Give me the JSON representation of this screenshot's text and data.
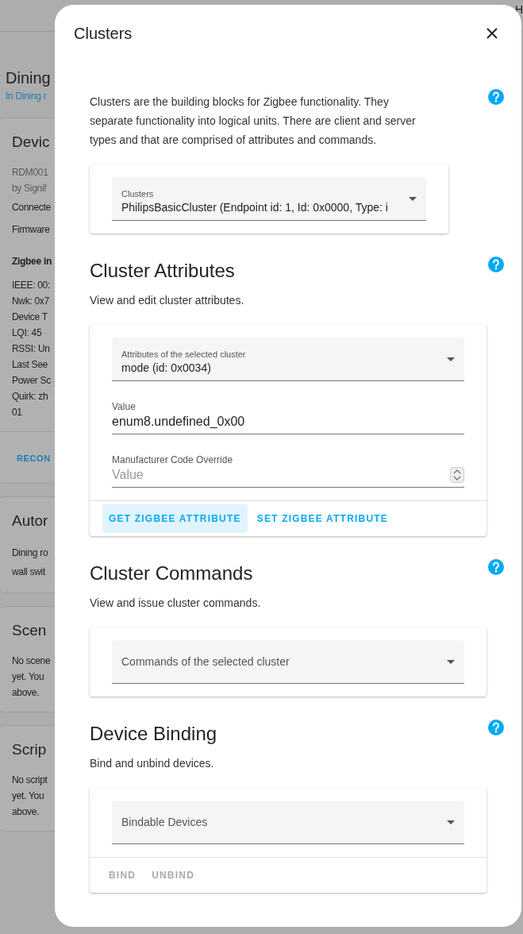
{
  "background": {
    "header_right": "H",
    "title": "Dining",
    "subtitle": "In Dining r",
    "cards": [
      {
        "title": "Devic",
        "lines": [
          {
            "kind": "muted",
            "text": "RDM001"
          },
          {
            "kind": "muted",
            "text": "by Signif"
          },
          {
            "kind": "gap",
            "text": "Connecte"
          },
          {
            "kind": "gap",
            "text": "Firmware"
          },
          {
            "kind": "bold",
            "text": "Zigbee in"
          },
          {
            "kind": "text",
            "text": "IEEE: 00:"
          },
          {
            "kind": "text",
            "text": "Nwk: 0x7"
          },
          {
            "kind": "text",
            "text": "Device T"
          },
          {
            "kind": "text",
            "text": "LQI: 45"
          },
          {
            "kind": "text",
            "text": "RSSI: Un"
          },
          {
            "kind": "text",
            "text": "Last See"
          },
          {
            "kind": "text",
            "text": "Power Sc"
          },
          {
            "kind": "text",
            "text": "Quirk: zh"
          },
          {
            "kind": "text",
            "text": "01"
          }
        ],
        "action": "RECON"
      },
      {
        "title": "Autor",
        "lines": [
          {
            "kind": "loose",
            "text": "Dining ro"
          },
          {
            "kind": "loose",
            "text": "wall swit"
          }
        ]
      },
      {
        "title": "Scen",
        "lines": [
          {
            "kind": "text",
            "text": "No scene"
          },
          {
            "kind": "text",
            "text": "yet. You"
          },
          {
            "kind": "text",
            "text": "above."
          }
        ]
      },
      {
        "title": "Scrip",
        "lines": [
          {
            "kind": "text",
            "text": "No script"
          },
          {
            "kind": "text",
            "text": "yet. You"
          },
          {
            "kind": "text",
            "text": "above."
          }
        ]
      }
    ]
  },
  "dialog": {
    "title": "Clusters",
    "sections": [
      {
        "description": "Clusters are the building blocks for Zigbee functionality. They separate functionality into logical units. There are client and server types and that are comprised of attributes and commands.",
        "wide": false,
        "fields": [
          {
            "kind": "select",
            "label": "Clusters",
            "value": "PhilipsBasicCluster (Endpoint id: 1, Id: 0x0000, Type: i"
          }
        ]
      },
      {
        "heading": "Cluster Attributes",
        "description": "View and edit cluster attributes.",
        "wide": true,
        "fields": [
          {
            "kind": "select",
            "label": "Attributes of the selected cluster",
            "value": "mode (id: 0x0034)"
          },
          {
            "kind": "text",
            "label": "Value",
            "value": "enum8.undefined_0x00"
          },
          {
            "kind": "number",
            "label": "Manufacturer Code Override",
            "placeholder": "Value"
          }
        ],
        "buttons": [
          {
            "label": "GET ZIGBEE ATTRIBUTE",
            "focused": true,
            "disabled": false
          },
          {
            "label": "SET ZIGBEE ATTRIBUTE",
            "focused": false,
            "disabled": false
          }
        ]
      },
      {
        "heading": "Cluster Commands",
        "description": "View and issue cluster commands.",
        "wide": true,
        "fields": [
          {
            "kind": "select",
            "label": "Commands of the selected cluster"
          }
        ]
      },
      {
        "heading": "Device Binding",
        "description": "Bind and unbind devices.",
        "wide": true,
        "fields": [
          {
            "kind": "select",
            "label": "Bindable Devices"
          }
        ],
        "buttons": [
          {
            "label": "BIND",
            "focused": false,
            "disabled": true
          },
          {
            "label": "UNBIND",
            "focused": false,
            "disabled": true
          }
        ]
      }
    ]
  }
}
